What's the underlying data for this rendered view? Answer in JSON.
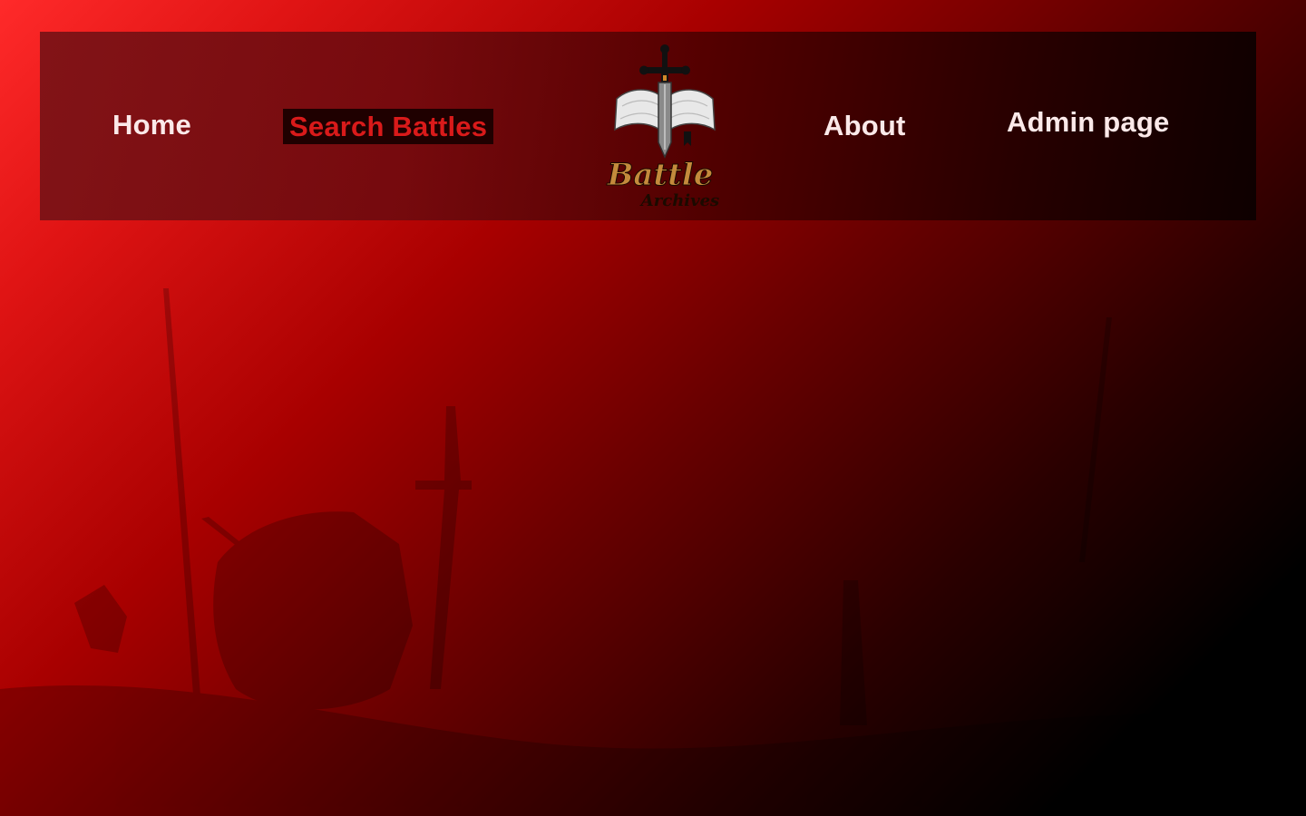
{
  "nav": {
    "home_label": "Home",
    "search_label": "Search Battles",
    "about_label": "About",
    "admin_label": "Admin page"
  },
  "logo": {
    "text_main": "Battle",
    "text_sub": "Archives",
    "icon": "sword-book-icon"
  },
  "colors": {
    "accent_red": "#d91a1a",
    "active_bg": "#1f0000",
    "nav_text": "#fbe9e9",
    "logo_gold": "#c48a3c"
  }
}
